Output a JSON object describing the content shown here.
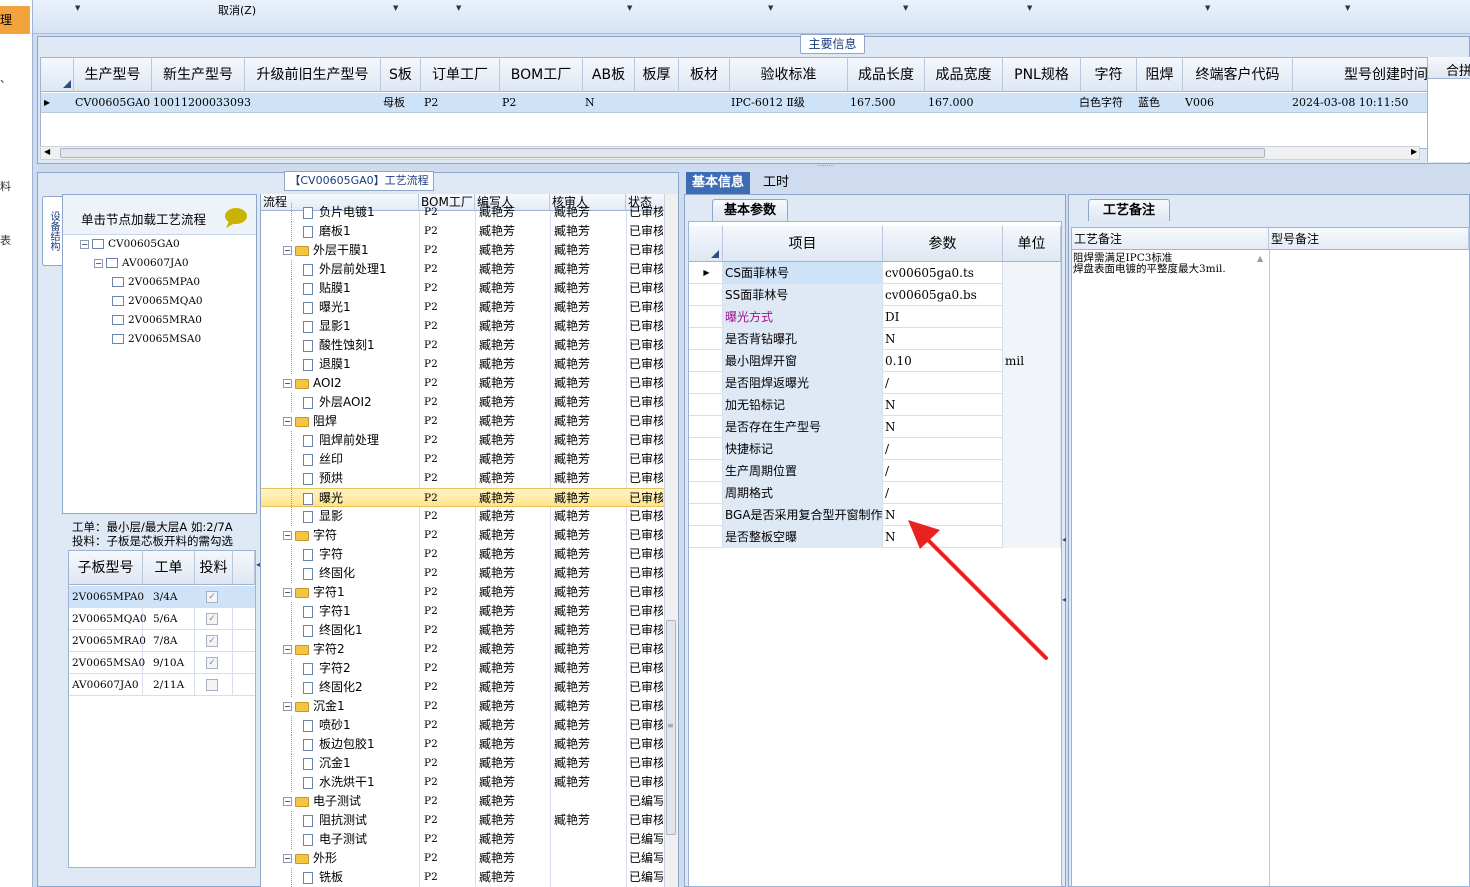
{
  "left_strip": {
    "selected_label": "理",
    "glyphs": [
      "、",
      "料",
      "表"
    ]
  },
  "toolbar": {
    "cancel_label": "取消(Z)"
  },
  "main_info": {
    "section_label": "主要信息",
    "columns": [
      "生产型号",
      "新生产型号",
      "升级前旧生产型号",
      "S板",
      "订单工厂",
      "BOM工厂",
      "AB板",
      "板厚",
      "板材",
      "验收标准",
      "成品长度",
      "成品宽度",
      "PNL规格",
      "字符",
      "阻焊",
      "终端客户代码",
      "型号创建时间"
    ],
    "row": {
      "生产型号": "CV00605GA0",
      "新生产型号": "10011200033093",
      "升级前旧生产型号": "",
      "S板": "母板",
      "订单工厂": "P2",
      "BOM工厂": "P2",
      "AB板": "N",
      "板厚": "",
      "板材": "",
      "验收标准": "IPC-6012 Ⅱ级",
      "成品长度": "167.500",
      "成品宽度": "167.000",
      "PNL规格": "",
      "字符": "白色字符",
      "阻焊": "蓝色",
      "终端客户代码": "V006",
      "型号创建时间": "2024-03-08 10:11:50"
    },
    "merge_label": "合拼"
  },
  "flow": {
    "section_label": "【CV00605GA0】工艺流程",
    "vertical_tab": "设备结构",
    "tree_hint": "单击节点加载工艺流程",
    "tree": [
      {
        "label": "CV00605GA0",
        "level": 0
      },
      {
        "label": "AV00607JA0",
        "level": 1
      },
      {
        "label": "2V0065MPA0",
        "level": 2
      },
      {
        "label": "2V0065MQA0",
        "level": 2
      },
      {
        "label": "2V0065MRA0",
        "level": 2
      },
      {
        "label": "2V0065MSA0",
        "level": 2
      }
    ],
    "work_note_1": "工单：最小层/最大层A 如:2/7A",
    "work_note_2": "投料：子板是芯板开料的需勾选",
    "sub_columns": [
      "子板型号",
      "工单",
      "投料"
    ],
    "sub_rows": [
      {
        "model": "2V0065MPA0",
        "order": "3/4A",
        "checked": true
      },
      {
        "model": "2V0065MQA0",
        "order": "5/6A",
        "checked": true
      },
      {
        "model": "2V0065MRA0",
        "order": "7/8A",
        "checked": true
      },
      {
        "model": "2V0065MSA0",
        "order": "9/10A",
        "checked": true
      },
      {
        "model": "AV00607JA0",
        "order": "2/11A",
        "checked": false
      }
    ],
    "columns": [
      "流程",
      "BOM工厂",
      "编写人",
      "核审人",
      "状态"
    ],
    "rows": [
      {
        "name": "负片电镀1",
        "type": "doc",
        "factory": "P2",
        "writer": "臧艳芳",
        "reviewer": "臧艳芳",
        "status": "已审核"
      },
      {
        "name": "磨板1",
        "type": "doc",
        "factory": "P2",
        "writer": "臧艳芳",
        "reviewer": "臧艳芳",
        "status": "已审核"
      },
      {
        "name": "外层干膜1",
        "type": "folder",
        "factory": "P2",
        "writer": "臧艳芳",
        "reviewer": "臧艳芳",
        "status": "已审核"
      },
      {
        "name": "外层前处理1",
        "type": "doc",
        "factory": "P2",
        "writer": "臧艳芳",
        "reviewer": "臧艳芳",
        "status": "已审核"
      },
      {
        "name": "贴膜1",
        "type": "doc",
        "factory": "P2",
        "writer": "臧艳芳",
        "reviewer": "臧艳芳",
        "status": "已审核"
      },
      {
        "name": "曝光1",
        "type": "doc",
        "factory": "P2",
        "writer": "臧艳芳",
        "reviewer": "臧艳芳",
        "status": "已审核"
      },
      {
        "name": "显影1",
        "type": "doc",
        "factory": "P2",
        "writer": "臧艳芳",
        "reviewer": "臧艳芳",
        "status": "已审核"
      },
      {
        "name": "酸性蚀刻1",
        "type": "doc",
        "factory": "P2",
        "writer": "臧艳芳",
        "reviewer": "臧艳芳",
        "status": "已审核"
      },
      {
        "name": "退膜1",
        "type": "doc",
        "factory": "P2",
        "writer": "臧艳芳",
        "reviewer": "臧艳芳",
        "status": "已审核"
      },
      {
        "name": "AOI2",
        "type": "folder",
        "factory": "P2",
        "writer": "臧艳芳",
        "reviewer": "臧艳芳",
        "status": "已审核"
      },
      {
        "name": "外层AOI2",
        "type": "doc",
        "factory": "P2",
        "writer": "臧艳芳",
        "reviewer": "臧艳芳",
        "status": "已审核"
      },
      {
        "name": "阻焊",
        "type": "folder",
        "factory": "P2",
        "writer": "臧艳芳",
        "reviewer": "臧艳芳",
        "status": "已审核"
      },
      {
        "name": "阻焊前处理",
        "type": "doc",
        "factory": "P2",
        "writer": "臧艳芳",
        "reviewer": "臧艳芳",
        "status": "已审核"
      },
      {
        "name": "丝印",
        "type": "doc",
        "factory": "P2",
        "writer": "臧艳芳",
        "reviewer": "臧艳芳",
        "status": "已审核"
      },
      {
        "name": "预烘",
        "type": "doc",
        "factory": "P2",
        "writer": "臧艳芳",
        "reviewer": "臧艳芳",
        "status": "已审核"
      },
      {
        "name": "曝光",
        "type": "doc",
        "factory": "P2",
        "writer": "臧艳芳",
        "reviewer": "臧艳芳",
        "status": "已审核",
        "selected": true
      },
      {
        "name": "显影",
        "type": "doc",
        "factory": "P2",
        "writer": "臧艳芳",
        "reviewer": "臧艳芳",
        "status": "已审核"
      },
      {
        "name": "字符",
        "type": "folder",
        "factory": "P2",
        "writer": "臧艳芳",
        "reviewer": "臧艳芳",
        "status": "已审核"
      },
      {
        "name": "字符",
        "type": "doc",
        "factory": "P2",
        "writer": "臧艳芳",
        "reviewer": "臧艳芳",
        "status": "已审核"
      },
      {
        "name": "终固化",
        "type": "doc",
        "factory": "P2",
        "writer": "臧艳芳",
        "reviewer": "臧艳芳",
        "status": "已审核"
      },
      {
        "name": "字符1",
        "type": "folder",
        "factory": "P2",
        "writer": "臧艳芳",
        "reviewer": "臧艳芳",
        "status": "已审核"
      },
      {
        "name": "字符1",
        "type": "doc",
        "factory": "P2",
        "writer": "臧艳芳",
        "reviewer": "臧艳芳",
        "status": "已审核"
      },
      {
        "name": "终固化1",
        "type": "doc",
        "factory": "P2",
        "writer": "臧艳芳",
        "reviewer": "臧艳芳",
        "status": "已审核"
      },
      {
        "name": "字符2",
        "type": "folder",
        "factory": "P2",
        "writer": "臧艳芳",
        "reviewer": "臧艳芳",
        "status": "已审核"
      },
      {
        "name": "字符2",
        "type": "doc",
        "factory": "P2",
        "writer": "臧艳芳",
        "reviewer": "臧艳芳",
        "status": "已审核"
      },
      {
        "name": "终固化2",
        "type": "doc",
        "factory": "P2",
        "writer": "臧艳芳",
        "reviewer": "臧艳芳",
        "status": "已审核"
      },
      {
        "name": "沉金1",
        "type": "folder",
        "factory": "P2",
        "writer": "臧艳芳",
        "reviewer": "臧艳芳",
        "status": "已审核"
      },
      {
        "name": "喷砂1",
        "type": "doc",
        "factory": "P2",
        "writer": "臧艳芳",
        "reviewer": "臧艳芳",
        "status": "已审核"
      },
      {
        "name": "板边包胶1",
        "type": "doc",
        "factory": "P2",
        "writer": "臧艳芳",
        "reviewer": "臧艳芳",
        "status": "已审核"
      },
      {
        "name": "沉金1",
        "type": "doc",
        "factory": "P2",
        "writer": "臧艳芳",
        "reviewer": "臧艳芳",
        "status": "已审核"
      },
      {
        "name": "水洗烘干1",
        "type": "doc",
        "factory": "P2",
        "writer": "臧艳芳",
        "reviewer": "臧艳芳",
        "status": "已审核"
      },
      {
        "name": "电子测试",
        "type": "folder",
        "factory": "P2",
        "writer": "臧艳芳",
        "reviewer": "",
        "status": "已编写"
      },
      {
        "name": "阻抗测试",
        "type": "doc",
        "factory": "P2",
        "writer": "臧艳芳",
        "reviewer": "臧艳芳",
        "status": "已审核"
      },
      {
        "name": "电子测试",
        "type": "doc",
        "factory": "P2",
        "writer": "臧艳芳",
        "reviewer": "",
        "status": "已编写"
      },
      {
        "name": "外形",
        "type": "folder",
        "factory": "P2",
        "writer": "臧艳芳",
        "reviewer": "",
        "status": "已编写"
      },
      {
        "name": "铣板",
        "type": "doc",
        "factory": "P2",
        "writer": "臧艳芳",
        "reviewer": "",
        "status": "已编写"
      }
    ]
  },
  "right": {
    "tabs": [
      "基本信息",
      "工时"
    ],
    "subtab": "基本参数",
    "param_columns": [
      "项目",
      "参数",
      "单位"
    ],
    "params": [
      {
        "item": "CS面菲林号",
        "value": "cv00605ga0.ts",
        "unit": "",
        "color": "#000000"
      },
      {
        "item": "SS面菲林号",
        "value": "cv00605ga0.bs",
        "unit": "",
        "color": "#000000"
      },
      {
        "item": "曝光方式",
        "value": "DI",
        "unit": "",
        "color": "#a0128f"
      },
      {
        "item": "是否背钻曝孔",
        "value": "N",
        "unit": "",
        "color": "#000000"
      },
      {
        "item": "最小阻焊开窗",
        "value": "0.10",
        "unit": "mil",
        "color": "#000000"
      },
      {
        "item": "是否阻焊返曝光",
        "value": "/",
        "unit": "",
        "color": "#000000"
      },
      {
        "item": "加无铅标记",
        "value": "N",
        "unit": "",
        "color": "#000000"
      },
      {
        "item": "是否存在生产型号",
        "value": "N",
        "unit": "",
        "color": "#000000"
      },
      {
        "item": "快捷标记",
        "value": "/",
        "unit": "",
        "color": "#000000"
      },
      {
        "item": "生产周期位置",
        "value": "/",
        "unit": "",
        "color": "#000000"
      },
      {
        "item": "周期格式",
        "value": "/",
        "unit": "",
        "color": "#000000"
      },
      {
        "item": "BGA是否采用复合型开窗制作",
        "value": "N",
        "unit": "",
        "color": "#000000"
      },
      {
        "item": "是否整板空曝",
        "value": "N",
        "unit": "",
        "color": "#000000"
      }
    ],
    "note_tab": "工艺备注",
    "note_columns": [
      "工艺备注",
      "型号备注"
    ],
    "note_lines": [
      "阻焊需满足IPC3标准",
      "焊盘表面电镀的平整度最大3mil."
    ],
    "arrow_color": "#e8231f"
  }
}
